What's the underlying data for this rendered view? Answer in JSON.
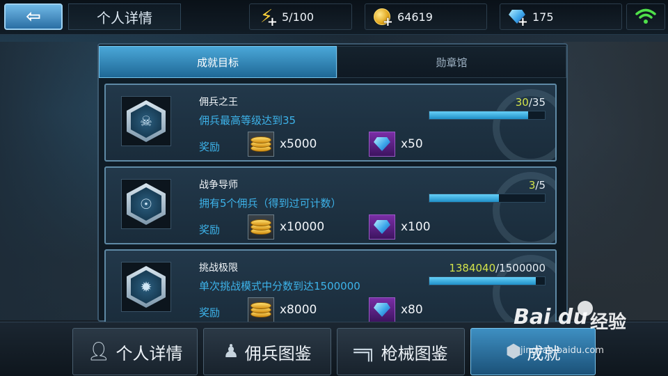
{
  "header": {
    "back_icon": "back-arrow-icon",
    "title": "个人详情",
    "energy": "5/100",
    "gold": "64619",
    "gems": "175",
    "wifi_icon": "wifi-icon"
  },
  "tabs": [
    {
      "label": "成就目标",
      "active": true
    },
    {
      "label": "勋章馆",
      "active": false
    }
  ],
  "achievements": [
    {
      "name": "佣兵之王",
      "desc": "佣兵最高等级达到35",
      "reward_label": "奖励",
      "gold_reward": "x5000",
      "gem_reward": "x50",
      "progress_current": "30",
      "progress_total": "/35",
      "progress_fraction": 0.857,
      "badge_icon": "hooded-mercenary-icon"
    },
    {
      "name": "战争导师",
      "desc": "拥有5个佣兵（得到过可计数）",
      "reward_label": "奖励",
      "gold_reward": "x10000",
      "gem_reward": "x100",
      "progress_current": "3",
      "progress_total": "/5",
      "progress_fraction": 0.6,
      "badge_icon": "gas-mask-icon"
    },
    {
      "name": "挑战极限",
      "desc": "单次挑战模式中分数到达1500000",
      "reward_label": "奖励",
      "gold_reward": "x8000",
      "gem_reward": "x80",
      "progress_current": "1384040",
      "progress_total": "/1500000",
      "progress_fraction": 0.923,
      "badge_icon": "star-burst-icon"
    }
  ],
  "bottom_nav": [
    {
      "label": "个人详情",
      "icon": "person-icon"
    },
    {
      "label": "佣兵图鉴",
      "icon": "soldier-icon"
    },
    {
      "label": "枪械图鉴",
      "icon": "rifle-icon"
    },
    {
      "label": "成就",
      "icon": "achievement-icon",
      "active": true
    }
  ],
  "watermark": {
    "logo": "Bai du",
    "cn": "经验",
    "url": "jingyan.baidu.com"
  },
  "colors": {
    "accent": "#3db3ea",
    "progress_highlight": "#d3e34a",
    "tab_active": "#2f86bd"
  }
}
